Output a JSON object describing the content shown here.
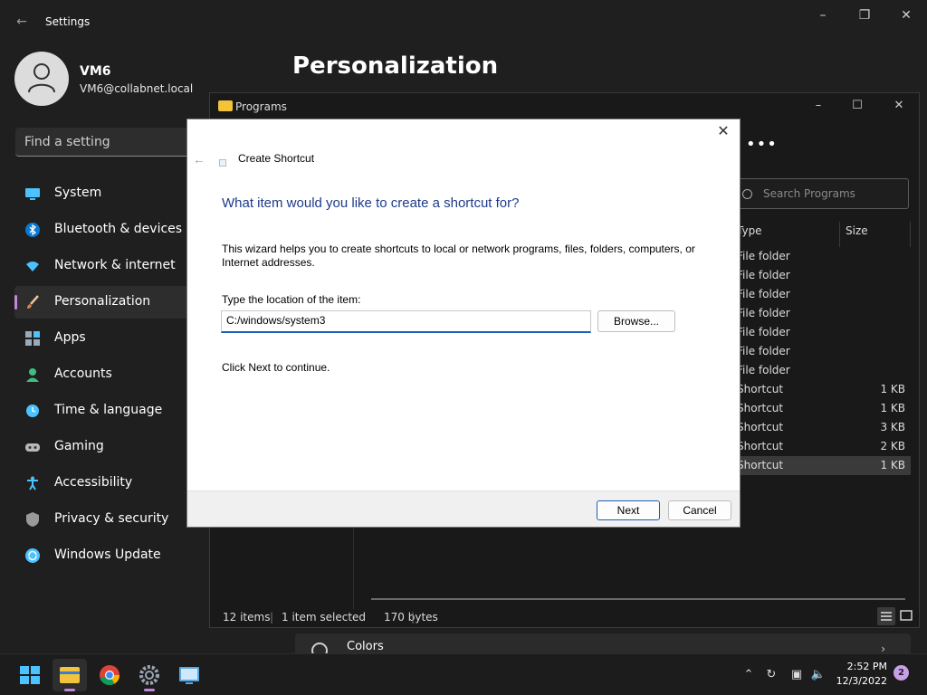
{
  "settings": {
    "title": "Settings",
    "user_name": "VM6",
    "user_email": "VM6@collabnet.local",
    "search_placeholder": "Find a setting",
    "page_title": "Personalization",
    "nav": [
      {
        "label": "System",
        "icon": "monitor-icon"
      },
      {
        "label": "Bluetooth & devices",
        "icon": "bluetooth-icon"
      },
      {
        "label": "Network & internet",
        "icon": "wifi-icon"
      },
      {
        "label": "Personalization",
        "icon": "brush-icon"
      },
      {
        "label": "Apps",
        "icon": "apps-icon"
      },
      {
        "label": "Accounts",
        "icon": "person-icon"
      },
      {
        "label": "Time & language",
        "icon": "clock-globe-icon"
      },
      {
        "label": "Gaming",
        "icon": "gamepad-icon"
      },
      {
        "label": "Accessibility",
        "icon": "accessibility-icon"
      },
      {
        "label": "Privacy & security",
        "icon": "shield-icon"
      },
      {
        "label": "Windows Update",
        "icon": "update-icon"
      }
    ],
    "active_nav": "Personalization",
    "colors_row_label": "Colors"
  },
  "explorer": {
    "title": "Programs",
    "search_placeholder": "Search Programs",
    "col_type": "Type",
    "col_size": "Size",
    "rows": [
      {
        "type": "File folder",
        "size": ""
      },
      {
        "type": "File folder",
        "size": ""
      },
      {
        "type": "File folder",
        "size": ""
      },
      {
        "type": "File folder",
        "size": ""
      },
      {
        "type": "File folder",
        "size": ""
      },
      {
        "type": "File folder",
        "size": ""
      },
      {
        "type": "File folder",
        "size": ""
      },
      {
        "type": "Shortcut",
        "size": "1 KB"
      },
      {
        "type": "Shortcut",
        "size": "1 KB"
      },
      {
        "type": "Shortcut",
        "size": "3 KB"
      },
      {
        "type": "Shortcut",
        "size": "2 KB"
      },
      {
        "type": "Shortcut",
        "size": "1 KB",
        "selected": true
      }
    ],
    "status": {
      "items": "12 items",
      "selected": "1 item selected",
      "size": "170 bytes"
    }
  },
  "dialog": {
    "title": "Create Shortcut",
    "heading": "What item would you like to create a shortcut for?",
    "description": "This wizard helps you to create shortcuts to local or network programs, files, folders, computers, or Internet addresses.",
    "location_label": "Type the location of the item:",
    "location_value": "C:/windows/system3",
    "browse_label": "Browse...",
    "hint": "Click Next to continue.",
    "next_label": "Next",
    "cancel_label": "Cancel"
  },
  "taskbar": {
    "apps": [
      "start-icon",
      "file-explorer-icon",
      "chrome-icon",
      "settings-icon",
      "remote-desktop-icon"
    ],
    "time": "2:52 PM",
    "date": "12/3/2022",
    "notification_count": "2"
  },
  "colors": {
    "accent": "#c08ad8",
    "link_heading": "#1e3b8a",
    "input_focus": "#1a5fb4"
  }
}
